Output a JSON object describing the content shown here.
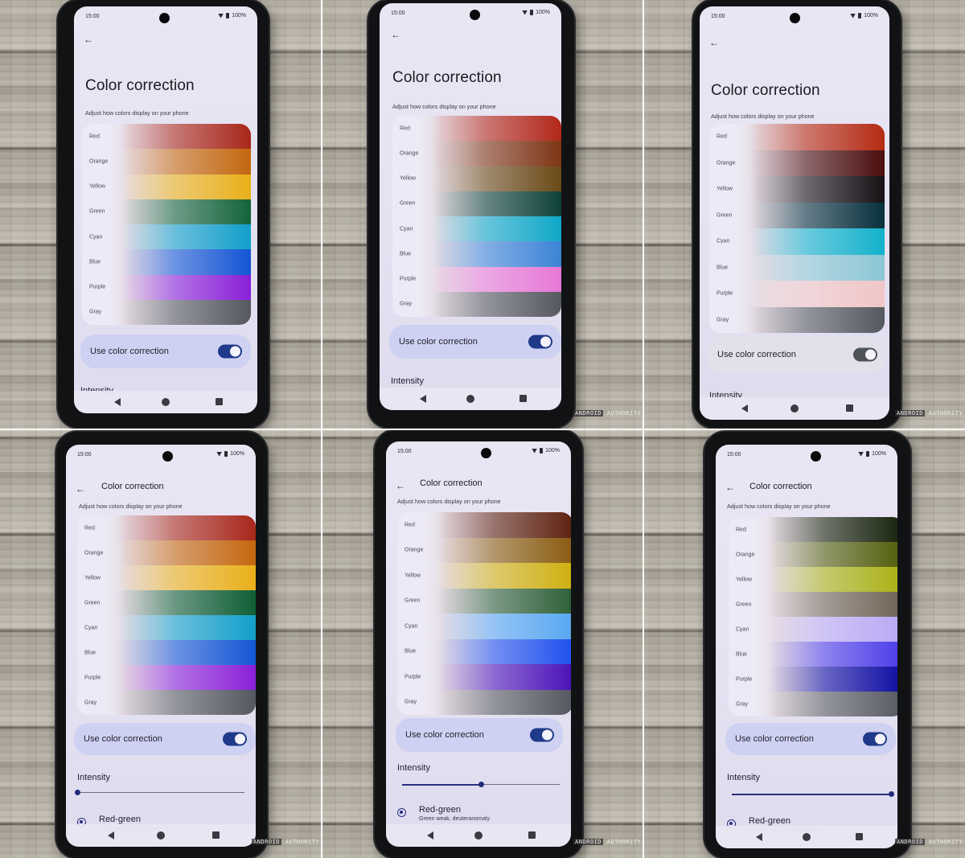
{
  "screen": {
    "status_time": "15:00",
    "battery": "100%",
    "title": "Color correction",
    "subtitle": "Adjust how colors display on your phone",
    "toggle_label": "Use color correction",
    "intensity_label": "Intensity",
    "mode_title": "Red-green",
    "mode_desc": "Green weak, deuteranomaly",
    "palette_labels": [
      "Red",
      "Orange",
      "Yellow",
      "Green",
      "Cyan",
      "Blue",
      "Purple",
      "Gray"
    ]
  },
  "watermark": {
    "brand_a": "ANDROID",
    "brand_b": "AUTHORITY"
  },
  "panels": [
    {
      "id": "top-left",
      "toggle_on": true,
      "intensity": null,
      "colors": [
        "#a8271a",
        "#c4670e",
        "#eab019",
        "#14643a",
        "#119fca",
        "#1355d4",
        "#8a1fd8",
        "#55585f"
      ]
    },
    {
      "id": "top-center",
      "toggle_on": true,
      "intensity": null,
      "colors": [
        "#b2281a",
        "#7e3514",
        "#6a4a16",
        "#0e4238",
        "#0fa8c8",
        "#3b84d6",
        "#e878d6",
        "#55585f"
      ]
    },
    {
      "id": "top-right",
      "toggle_on": true,
      "intensity": null,
      "colors": [
        "#b42a12",
        "#4a0d0c",
        "#161014",
        "#06303c",
        "#12b2cc",
        "#8cc6d4",
        "#f0c6c6",
        "#55585f"
      ]
    },
    {
      "id": "bottom-left",
      "toggle_on": true,
      "intensity": 0.0,
      "colors": [
        "#a8271a",
        "#c4670e",
        "#eab019",
        "#0f5e34",
        "#119fca",
        "#1355d4",
        "#8a1fd8",
        "#55585f"
      ]
    },
    {
      "id": "bottom-center",
      "toggle_on": true,
      "intensity": 0.5,
      "colors": [
        "#5e2210",
        "#8a5c10",
        "#d0b010",
        "#2e6038",
        "#58a8f2",
        "#2050ee",
        "#4a12b8",
        "#55585f"
      ]
    },
    {
      "id": "bottom-right",
      "toggle_on": true,
      "intensity": 1.0,
      "colors": [
        "#142008",
        "#505c08",
        "#a8b010",
        "#6e6252",
        "#b8a8f4",
        "#4a3ae8",
        "#0c0aa0",
        "#55585f"
      ]
    }
  ]
}
